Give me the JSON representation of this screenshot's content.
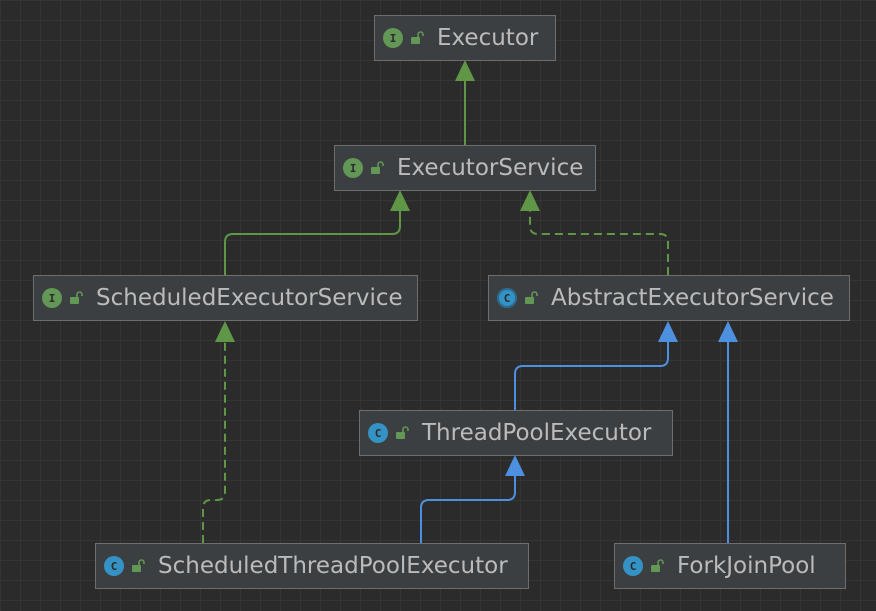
{
  "colors": {
    "interface": "#629755",
    "class": "#3592c4",
    "interface_edge": "#5f9747",
    "class_edge": "#4d90e0",
    "visibility": "#629755"
  },
  "nodes": {
    "executor": {
      "name": "Executor",
      "kind": "interface",
      "badge": "I",
      "visibility_icon": "lock-open-icon"
    },
    "executor_service": {
      "name": "ExecutorService",
      "kind": "interface",
      "badge": "I",
      "visibility_icon": "lock-open-icon"
    },
    "scheduled_executor_service": {
      "name": "ScheduledExecutorService",
      "kind": "interface",
      "badge": "I",
      "visibility_icon": "lock-open-icon"
    },
    "abstract_executor_service": {
      "name": "AbstractExecutorService",
      "kind": "abstract-class",
      "badge": "C",
      "visibility_icon": "lock-open-icon"
    },
    "thread_pool_executor": {
      "name": "ThreadPoolExecutor",
      "kind": "class",
      "badge": "C",
      "visibility_icon": "lock-open-icon"
    },
    "scheduled_thread_pool_executor": {
      "name": "ScheduledThreadPoolExecutor",
      "kind": "class",
      "badge": "C",
      "visibility_icon": "lock-open-icon"
    },
    "fork_join_pool": {
      "name": "ForkJoinPool",
      "kind": "class",
      "badge": "C",
      "visibility_icon": "lock-open-icon"
    }
  },
  "edges": [
    {
      "from": "executor_service",
      "to": "executor",
      "relation": "extends",
      "style": "solid",
      "color": "#5f9747"
    },
    {
      "from": "scheduled_executor_service",
      "to": "executor_service",
      "relation": "extends",
      "style": "solid",
      "color": "#5f9747"
    },
    {
      "from": "abstract_executor_service",
      "to": "executor_service",
      "relation": "implements",
      "style": "dashed",
      "color": "#5f9747"
    },
    {
      "from": "thread_pool_executor",
      "to": "abstract_executor_service",
      "relation": "extends",
      "style": "solid",
      "color": "#4d90e0"
    },
    {
      "from": "fork_join_pool",
      "to": "abstract_executor_service",
      "relation": "extends",
      "style": "solid",
      "color": "#4d90e0"
    },
    {
      "from": "scheduled_thread_pool_executor",
      "to": "thread_pool_executor",
      "relation": "extends",
      "style": "solid",
      "color": "#4d90e0"
    },
    {
      "from": "scheduled_thread_pool_executor",
      "to": "scheduled_executor_service",
      "relation": "implements",
      "style": "dashed",
      "color": "#5f9747"
    }
  ]
}
